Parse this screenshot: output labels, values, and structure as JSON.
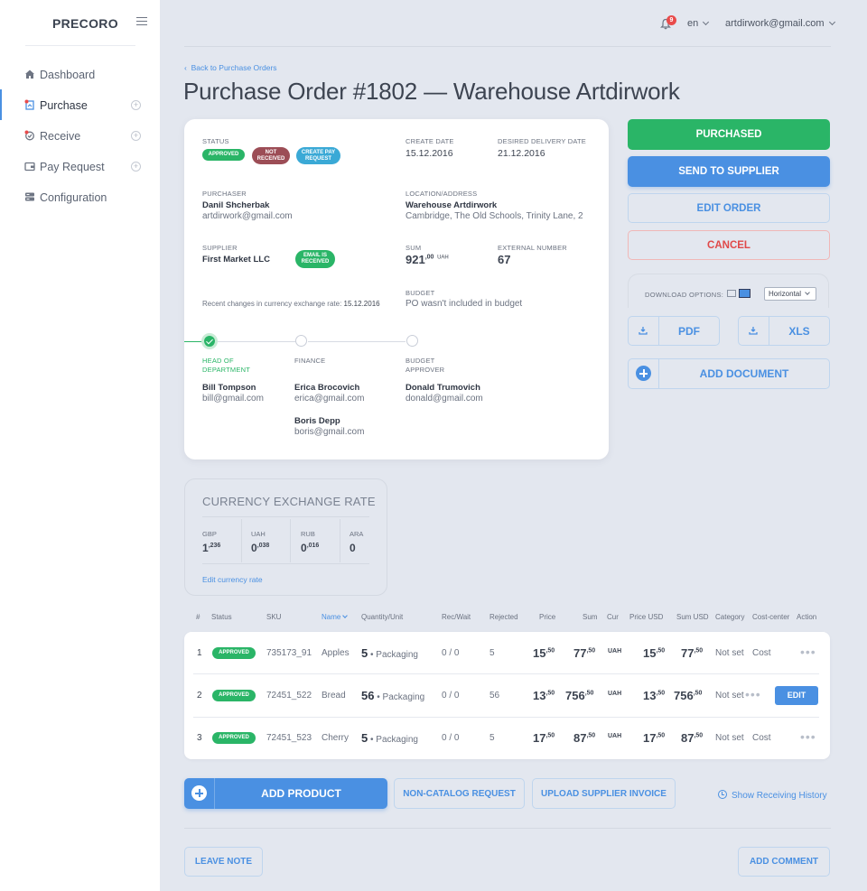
{
  "app": {
    "logo": "PRECORO"
  },
  "sidebar": {
    "items": [
      {
        "label": "Dashboard",
        "icon": "home-icon"
      },
      {
        "label": "Purchase",
        "icon": "purchase-icon"
      },
      {
        "label": "Receive",
        "icon": "receive-icon"
      },
      {
        "label": "Pay Request",
        "icon": "wallet-icon"
      },
      {
        "label": "Configuration",
        "icon": "configuration-icon"
      }
    ]
  },
  "topbar": {
    "notifications": "9",
    "language": "en",
    "user_email": "artdirwork@gmail.com"
  },
  "breadcrumb": {
    "back": "Back to Purchase Orders"
  },
  "page_title": "Purchase Order #1802 — Warehouse Artdirwork",
  "order": {
    "status_label": "STATUS",
    "badges": [
      "APPROVED",
      "NOT RECEIVED",
      "CREATE PAY REQUEST"
    ],
    "create_date_label": "CREATE DATE",
    "create_date": "15.12.2016",
    "delivery_label": "DESIRED DELIVERY DATE",
    "delivery_date": "21.12.2016",
    "purchaser_label": "PURCHASER",
    "purchaser_name": "Danil Shcherbak",
    "purchaser_email": "artdirwork@gmail.com",
    "location_label": "LOCATION/ADDRESS",
    "location_name": "Warehouse Artdirwork",
    "location_address": "Cambridge, The Old Schools, Trinity Lane, 2",
    "supplier_label": "SUPPLIER",
    "supplier_name": "First Market LLC",
    "email_badge": "EMAIL IS RECEIVED",
    "sum_label": "SUM",
    "sum_int": "921",
    "sum_dec": ",00",
    "sum_currency": "UAH",
    "external_label": "EXTERNAL NUMBER",
    "external_number": "67",
    "recent_changes": "Recent changes in currency exchange rate:",
    "recent_date": "15.12.2016",
    "budget_label": "BUDGET",
    "budget_value": "PO wasn't included in budget"
  },
  "approval": {
    "steps": [
      {
        "role": "HEAD OF DEPARTMENT",
        "done": true,
        "people": [
          {
            "name": "Bill Tompson",
            "email": "bill@gmail.com"
          }
        ]
      },
      {
        "role": "FINANCE",
        "done": false,
        "people": [
          {
            "name": "Erica Brocovich",
            "email": "erica@gmail.com"
          },
          {
            "name": "Boris Depp",
            "email": "boris@gmail.com"
          }
        ]
      },
      {
        "role": "BUDGET APPROVER",
        "done": false,
        "people": [
          {
            "name": "Donald Trumovich",
            "email": "donald@gmail.com"
          }
        ]
      }
    ]
  },
  "actions": {
    "purchased": "PURCHASED",
    "send": "SEND TO SUPPLIER",
    "edit": "EDIT ORDER",
    "cancel": "CANCEL",
    "download_label": "DOWNLOAD OPTIONS:",
    "orientation": "Horizontal",
    "pdf": "PDF",
    "xls": "XLS",
    "add_document": "ADD DOCUMENT"
  },
  "currency": {
    "title": "CURRENCY EXCHANGE RATE",
    "rates": [
      {
        "code": "GBP",
        "int": "1",
        "dec": ",236"
      },
      {
        "code": "UAH",
        "int": "0",
        "dec": ",038"
      },
      {
        "code": "RUB",
        "int": "0",
        "dec": ",016"
      },
      {
        "code": "ARA",
        "int": "0",
        "dec": ""
      }
    ],
    "edit_link": "Edit currency rate"
  },
  "table": {
    "headers": [
      "#",
      "Status",
      "SKU",
      "Name",
      "Quantity/Unit",
      "Rec/Wait",
      "Rejected",
      "Price",
      "Sum",
      "Cur",
      "Price USD",
      "Sum USD",
      "Category",
      "Cost-center",
      "Action"
    ],
    "rows": [
      {
        "n": "1",
        "status": "APPROVED",
        "sku": "735173_91",
        "name": "Apples",
        "qty": "5",
        "unit": "Packaging",
        "rec": "0 / 0",
        "rejected": "5",
        "price": "15",
        "price_dec": ",50",
        "sum": "77",
        "sum_dec": ",50",
        "cur": "UAH",
        "price_usd": "15",
        "price_usd_dec": ",50",
        "sum_usd": "77",
        "sum_usd_dec": ",50",
        "category": "Not set",
        "cost": "Cost"
      },
      {
        "n": "2",
        "status": "APPROVED",
        "sku": "72451_522",
        "name": "Bread",
        "qty": "56",
        "unit": "Packaging",
        "rec": "0 / 0",
        "rejected": "56",
        "price": "13",
        "price_dec": ",50",
        "sum": "756",
        "sum_dec": ",50",
        "cur": "UAH",
        "price_usd": "13",
        "price_usd_dec": ",50",
        "sum_usd": "756",
        "sum_usd_dec": ",50",
        "category": "Not set",
        "cost": "",
        "action": "EDIT"
      },
      {
        "n": "3",
        "status": "APPROVED",
        "sku": "72451_523",
        "name": "Cherry",
        "qty": "5",
        "unit": "Packaging",
        "rec": "0 / 0",
        "rejected": "5",
        "price": "17",
        "price_dec": ",50",
        "sum": "87",
        "sum_dec": ",50",
        "cur": "UAH",
        "price_usd": "17",
        "price_usd_dec": ",50",
        "sum_usd": "87",
        "sum_usd_dec": ",50",
        "category": "Not set",
        "cost": "Cost"
      }
    ]
  },
  "bottom": {
    "add_product": "ADD PRODUCT",
    "non_catalog": "NON-CATALOG REQUEST",
    "upload_invoice": "UPLOAD SUPPLIER INVOICE",
    "history": "Show Receiving History",
    "leave_note": "LEAVE NOTE",
    "add_comment": "ADD COMMENT"
  },
  "colors": {
    "accent": "#4a90e2",
    "success": "#2ab567",
    "danger": "#e04949",
    "background": "#e3e7ef"
  }
}
